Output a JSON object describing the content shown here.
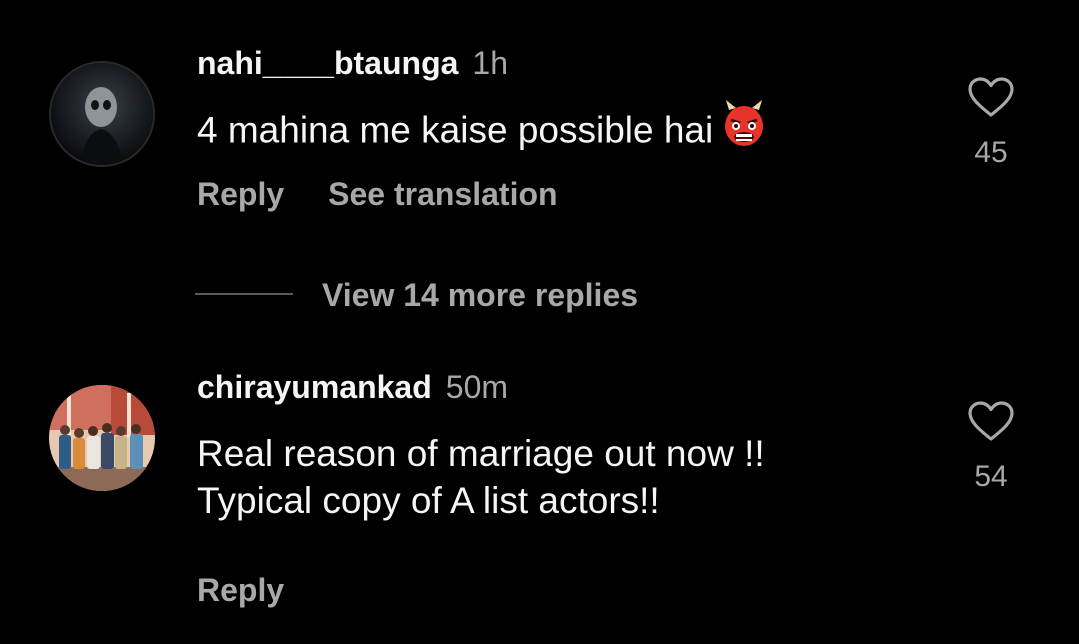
{
  "comments": [
    {
      "username": "nahi____btaunga",
      "time": "1h",
      "text": "4 mahina me kaise possible hai",
      "emoji": "ogre-emoji",
      "likes": "45",
      "reply_label": "Reply",
      "translate_label": "See translation"
    },
    {
      "username": "chirayumankad",
      "time": "50m",
      "text_lines": [
        "Real reason of marriage out now !!",
        "Typical copy of A list actors!!"
      ],
      "likes": "54",
      "reply_label": "Reply"
    }
  ],
  "view_replies": {
    "label": "View 14 more replies"
  },
  "colors": {
    "background": "#000000",
    "primary_text": "#f5f5f5",
    "secondary_text": "#a8a8a8",
    "emoji_red": "#e8332b"
  },
  "icons": [
    "heart-outline-icon",
    "ogre-emoji"
  ]
}
